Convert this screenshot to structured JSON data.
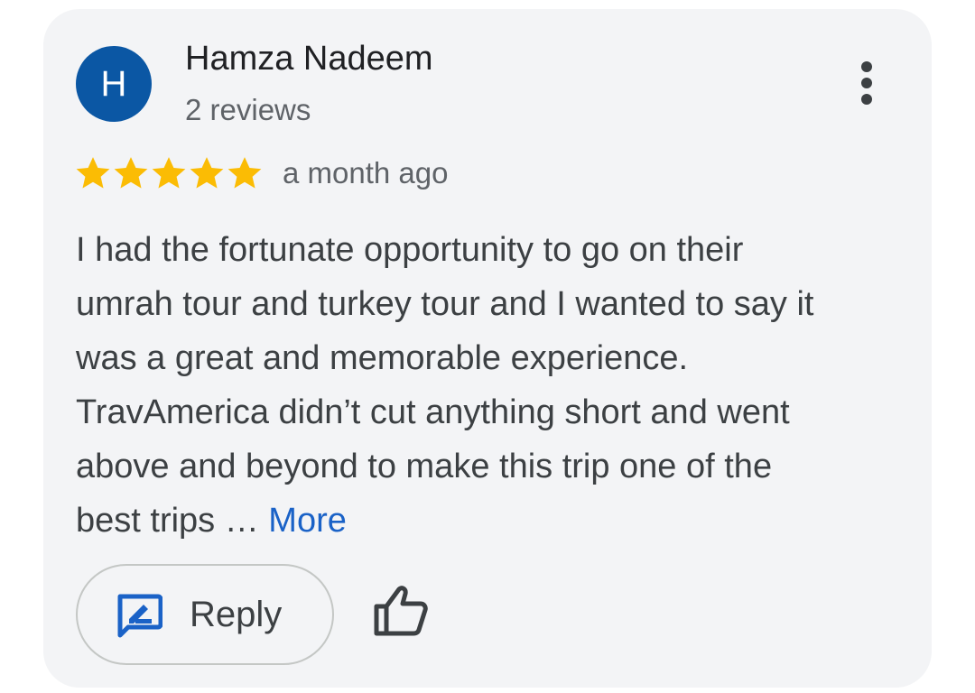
{
  "review": {
    "avatar_letter": "H",
    "avatar_color": "#0b57a4",
    "reviewer_name": "Hamza Nadeem",
    "review_count": "2 reviews",
    "rating": 5,
    "rating_max": 5,
    "star_color": "#fbbc04",
    "time": "a month ago",
    "text_lines": [
      "I had the fortunate opportunity to go on their",
      "umrah tour and turkey tour and I wanted to say it",
      "was a great and memorable experience.",
      "TravAmerica didn’t cut anything short and went",
      "above and beyond to make this trip one of the",
      "best trips … "
    ],
    "more_label": "More",
    "link_color": "#1a62c7"
  },
  "actions": {
    "reply_label": "Reply",
    "reply_icon": "reply-edit-icon",
    "like_icon": "thumbs-up-icon",
    "more_options_icon": "more-vert-icon"
  }
}
